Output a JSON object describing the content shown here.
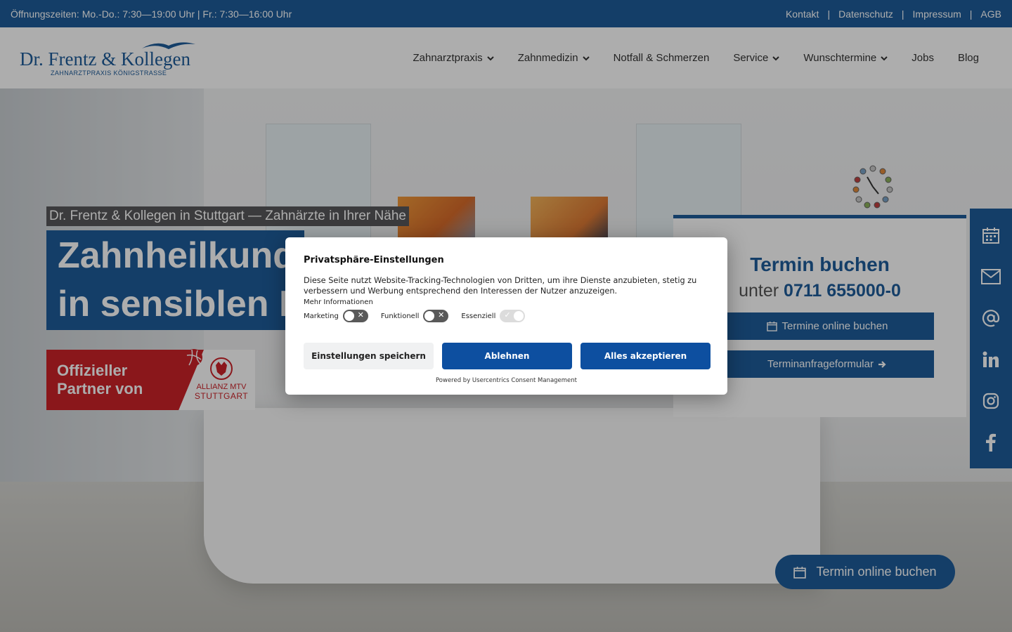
{
  "topbar": {
    "hours": "Öffnungszeiten: Mo.-Do.: 7:30—19:00 Uhr | Fr.: 7:30—16:00 Uhr",
    "links": [
      "Kontakt",
      "Datenschutz",
      "Impressum",
      "AGB"
    ],
    "separator": "|"
  },
  "logo": {
    "main": "Dr. Frentz & Kollegen",
    "sub": "ZAHNARZTPRAXIS KÖNIGSTRASSE"
  },
  "nav": {
    "items": [
      {
        "label": "Zahnarztpraxis",
        "icon": "chevron-down-icon"
      },
      {
        "label": "Zahnmedizin",
        "icon": "chevron-down-icon"
      },
      {
        "label": "Notfall & Schmerzen"
      },
      {
        "label": "Service",
        "icon": "chevron-down-icon"
      },
      {
        "label": "Wunschtermine",
        "icon": "chevron-down-icon"
      },
      {
        "label": "Jobs"
      },
      {
        "label": "Blog"
      }
    ]
  },
  "hero": {
    "subtitle": "Dr. Frentz & Kollegen in Stuttgart — Zahnärzte in Ihrer Nähe",
    "title_line1": "Zahnheilkunde",
    "title_line2": "in sensiblen Hä",
    "partner_line1": "Offizieller",
    "partner_line2": "Partner von",
    "partner_logo_line1": "ALLIANZ MTV",
    "partner_logo_line2": "STUTTGART"
  },
  "booking": {
    "title": "Termin buchen",
    "phone_prefix": "unter",
    "phone": "0711 655000-0",
    "button1": "Termine online buchen",
    "button2": "Terminanfrageformular"
  },
  "side_social": [
    "calendar-icon",
    "mail-icon",
    "at-icon",
    "linkedin-icon",
    "instagram-icon",
    "facebook-icon"
  ],
  "float_button": "Termin online buchen",
  "consent": {
    "title": "Privatsphäre-Einstellungen",
    "text": "Diese Seite nutzt Website-Tracking-Technologien von Dritten, um ihre Dienste anzubieten, stetig zu verbessern und Werbung entsprechend den Interessen der Nutzer anzuzeigen.",
    "more": "Mehr Informationen",
    "toggles": [
      {
        "label": "Marketing",
        "state": "off"
      },
      {
        "label": "Funktionell",
        "state": "off"
      },
      {
        "label": "Essenziell",
        "state": "on"
      }
    ],
    "btn_save": "Einstellungen speichern",
    "btn_reject": "Ablehnen",
    "btn_accept": "Alles akzeptieren",
    "powered": "Powered by Usercentrics Consent Management"
  },
  "colors": {
    "brand_blue": "#1e5c9a",
    "consent_blue": "#0d4fa0",
    "partner_red": "#cc2229"
  }
}
